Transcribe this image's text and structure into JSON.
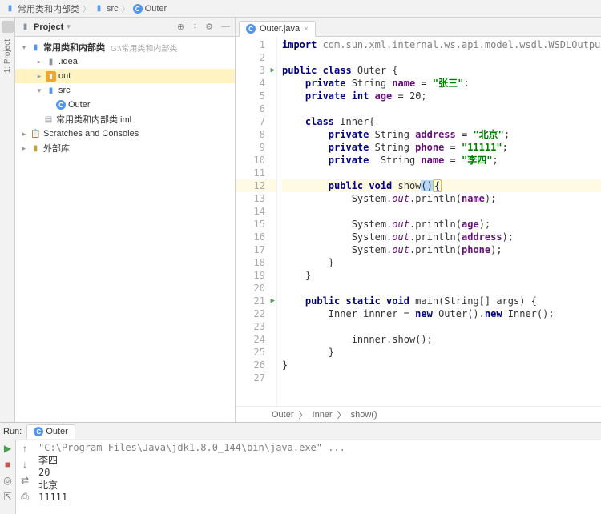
{
  "breadcrumb": {
    "project": "常用类和内部类",
    "src": "src",
    "cls": "Outer"
  },
  "project_panel": {
    "title": "Project",
    "root": "常用类和内部类",
    "root_loc": "G:\\常用类和内部类",
    "items": {
      "idea": ".idea",
      "out": "out",
      "src": "src",
      "outer": "Outer",
      "iml": "常用类和内部类.iml",
      "scratches": "Scratches and Consoles",
      "ext": "外部库"
    }
  },
  "tab": {
    "name": "Outer.java"
  },
  "editor_bc": {
    "a": "Outer",
    "b": "Inner",
    "c": "show()"
  },
  "side": {
    "project": "1: Project"
  },
  "run": {
    "label": "Run:",
    "name": "Outer",
    "cmd": "\"C:\\Program Files\\Java\\jdk1.8.0_144\\bin\\java.exe\" ...",
    "out1": "李四",
    "out2": "20",
    "out3": "北京",
    "out4": "11111"
  },
  "code": {
    "l1": {
      "imp": "import ",
      "pkg": "com.sun.xml.internal.ws.api.model.wsdl.WSDLOutput;"
    },
    "l3": {
      "a": "public class ",
      "b": "Outer {"
    },
    "l4": {
      "a": "    private ",
      "b": "String ",
      "n": "name",
      "c": " = ",
      "s": "\"张三\"",
      "d": ";"
    },
    "l5": {
      "a": "    private int ",
      "n": "age",
      "c": " = ",
      "v": "20",
      ";": ";"
    },
    "l7": {
      "a": "    class ",
      "b": "Inner{"
    },
    "l8": {
      "a": "        private ",
      "b": "String ",
      "n": "address",
      "c": " = ",
      "s": "\"北京\"",
      "d": ";"
    },
    "l9": {
      "a": "        private ",
      "b": "String ",
      "n": "phone",
      "c": " = ",
      "s": "\"11111\"",
      "d": ";"
    },
    "l10": {
      "a": "        private  ",
      "b": "String ",
      "n": "name",
      "c": " = ",
      "s": "\"李四\"",
      "d": ";"
    },
    "l12": {
      "a": "        public void ",
      "m": "show",
      "p": "()",
      "b": "{"
    },
    "l13": {
      "a": "            System.",
      "o": "out",
      "b": ".println(",
      "n": "name",
      "c": ");"
    },
    "l15": {
      "a": "            System.",
      "o": "out",
      "b": ".println(",
      "n": "age",
      "c": ");"
    },
    "l16": {
      "a": "            System.",
      "o": "out",
      "b": ".println(",
      "n": "address",
      "c": ");"
    },
    "l17": {
      "a": "            System.",
      "o": "out",
      "b": ".println(",
      "n": "phone",
      "c": ");"
    },
    "l18": "        }",
    "l19": "    }",
    "l21": {
      "a": "    public static void ",
      "m": "main(String[] args) {"
    },
    "l22": {
      "a": "        Inner innner = ",
      "n": "new ",
      "b": "Outer().",
      "n2": "new ",
      "c": "Inner();"
    },
    "l24": "            innner.show();",
    "l25": "        }",
    "l26": "}"
  }
}
